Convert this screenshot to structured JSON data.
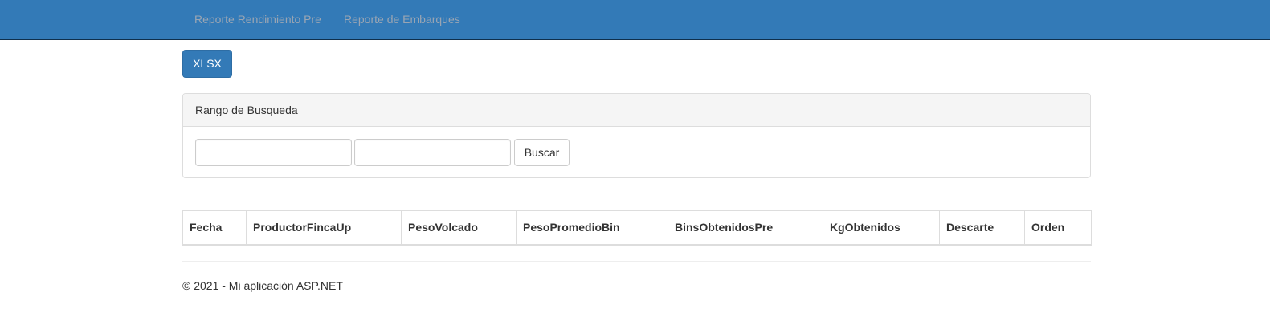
{
  "navbar": {
    "links": [
      {
        "label": "Reporte Rendimiento Pre"
      },
      {
        "label": "Reporte de Embarques"
      }
    ]
  },
  "toolbar": {
    "export_label": "XLSX"
  },
  "search_panel": {
    "heading": "Rango de Busqueda",
    "start_value": "",
    "end_value": "",
    "search_label": "Buscar"
  },
  "table": {
    "headers": [
      "Fecha",
      "ProductorFincaUp",
      "PesoVolcado",
      "PesoPromedioBin",
      "BinsObtenidosPre",
      "KgObtenidos",
      "Descarte",
      "Orden"
    ],
    "rows": []
  },
  "footer": {
    "text": "© 2021 - Mi aplicación ASP.NET"
  },
  "colors": {
    "navbar_bg": "#337ab7",
    "primary_button": "#337ab7",
    "nav_link_text": "#9aa5b3"
  }
}
